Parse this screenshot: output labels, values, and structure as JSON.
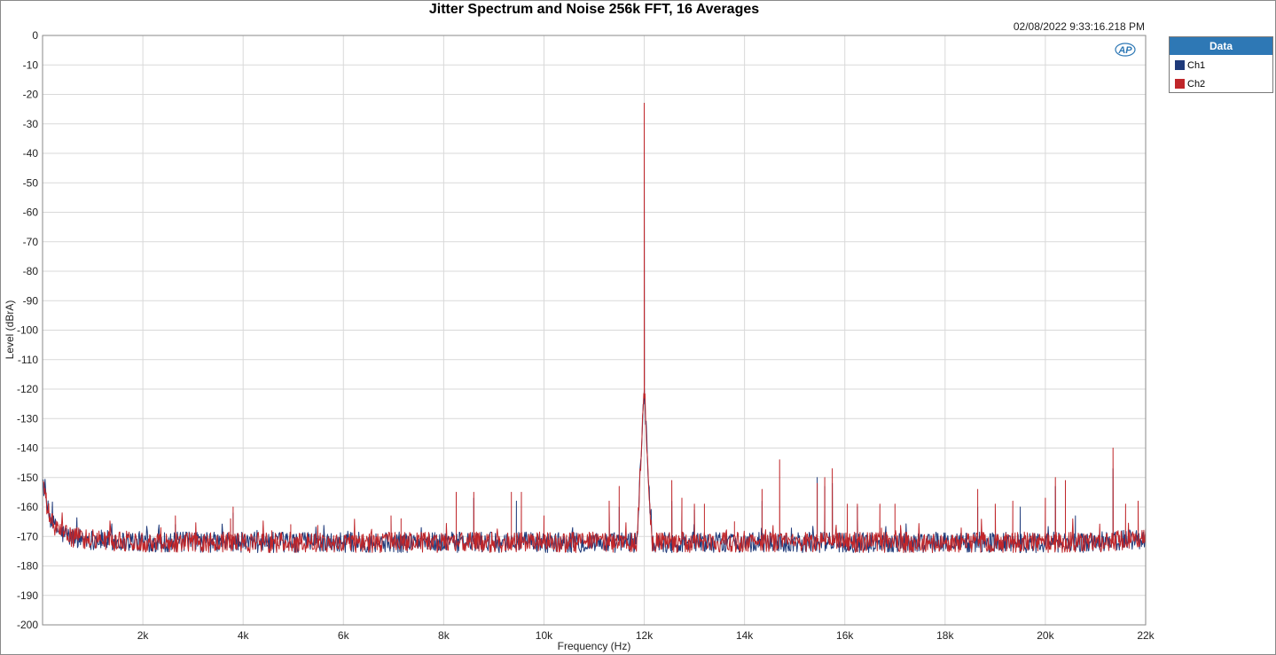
{
  "timestamp": "02/08/2022 9:33:16.218 PM",
  "legend": {
    "header": "Data",
    "items": [
      {
        "label": "Ch1",
        "color": "#1f3a7a"
      },
      {
        "label": "Ch2",
        "color": "#c0262a"
      }
    ]
  },
  "logo_text": "AP",
  "chart_data": {
    "type": "line",
    "title": "Jitter Spectrum and Noise 256k FFT, 16 Averages",
    "xlabel": "Frequency (Hz)",
    "ylabel": "Level (dBrA)",
    "xlim": [
      0,
      22000
    ],
    "ylim": [
      -200,
      0
    ],
    "x_ticks": [
      2000,
      4000,
      6000,
      8000,
      10000,
      12000,
      14000,
      16000,
      18000,
      20000,
      22000
    ],
    "x_tick_labels": [
      "2k",
      "4k",
      "6k",
      "8k",
      "10k",
      "12k",
      "14k",
      "16k",
      "18k",
      "20k",
      "22k"
    ],
    "y_ticks": [
      0,
      -10,
      -20,
      -30,
      -40,
      -50,
      -60,
      -70,
      -80,
      -90,
      -100,
      -110,
      -120,
      -130,
      -140,
      -150,
      -160,
      -170,
      -180,
      -190,
      -200
    ],
    "y_tick_labels": [
      "0",
      "-10",
      "-20",
      "-30",
      "-40",
      "-50",
      "-60",
      "-70",
      "-80",
      "-90",
      "-100",
      "-110",
      "-120",
      "-130",
      "-140",
      "-150",
      "-160",
      "-170",
      "-180",
      "-190",
      "-200"
    ],
    "grid": true,
    "legend_position": "right",
    "noise_floor": -172,
    "series": [
      {
        "name": "Ch1",
        "color": "#1f3a7a",
        "peaks": [
          [
            12000,
            -23
          ],
          [
            2650,
            -166
          ],
          [
            3800,
            -162
          ],
          [
            6950,
            -164
          ],
          [
            8250,
            -158
          ],
          [
            8600,
            -157
          ],
          [
            9450,
            -158
          ],
          [
            11300,
            -161
          ],
          [
            11500,
            -160
          ],
          [
            12550,
            -158
          ],
          [
            12750,
            -160
          ],
          [
            13000,
            -161
          ],
          [
            14350,
            -158
          ],
          [
            15450,
            -150
          ],
          [
            15600,
            -153
          ],
          [
            15750,
            -152
          ],
          [
            16250,
            -160
          ],
          [
            18650,
            -160
          ],
          [
            19500,
            -160
          ],
          [
            20200,
            -153
          ],
          [
            20600,
            -163
          ],
          [
            21350,
            -147
          ]
        ]
      },
      {
        "name": "Ch2",
        "color": "#c0262a",
        "peaks": [
          [
            12000,
            -23
          ],
          [
            2650,
            -163
          ],
          [
            3750,
            -164
          ],
          [
            3800,
            -160
          ],
          [
            4950,
            -166
          ],
          [
            6950,
            -163
          ],
          [
            7150,
            -164
          ],
          [
            8250,
            -155
          ],
          [
            8600,
            -155
          ],
          [
            9350,
            -155
          ],
          [
            9550,
            -155
          ],
          [
            10000,
            -163
          ],
          [
            11300,
            -158
          ],
          [
            11500,
            -153
          ],
          [
            12550,
            -151
          ],
          [
            12750,
            -157
          ],
          [
            13000,
            -159
          ],
          [
            13200,
            -159
          ],
          [
            13800,
            -165
          ],
          [
            14350,
            -154
          ],
          [
            14700,
            -144
          ],
          [
            15450,
            -152
          ],
          [
            15600,
            -150
          ],
          [
            15750,
            -147
          ],
          [
            16050,
            -159
          ],
          [
            16250,
            -159
          ],
          [
            16700,
            -159
          ],
          [
            17000,
            -159
          ],
          [
            18650,
            -154
          ],
          [
            19000,
            -159
          ],
          [
            19350,
            -158
          ],
          [
            20000,
            -157
          ],
          [
            20200,
            -150
          ],
          [
            20400,
            -151
          ],
          [
            21350,
            -140
          ],
          [
            21600,
            -159
          ],
          [
            21850,
            -158
          ]
        ]
      }
    ]
  }
}
